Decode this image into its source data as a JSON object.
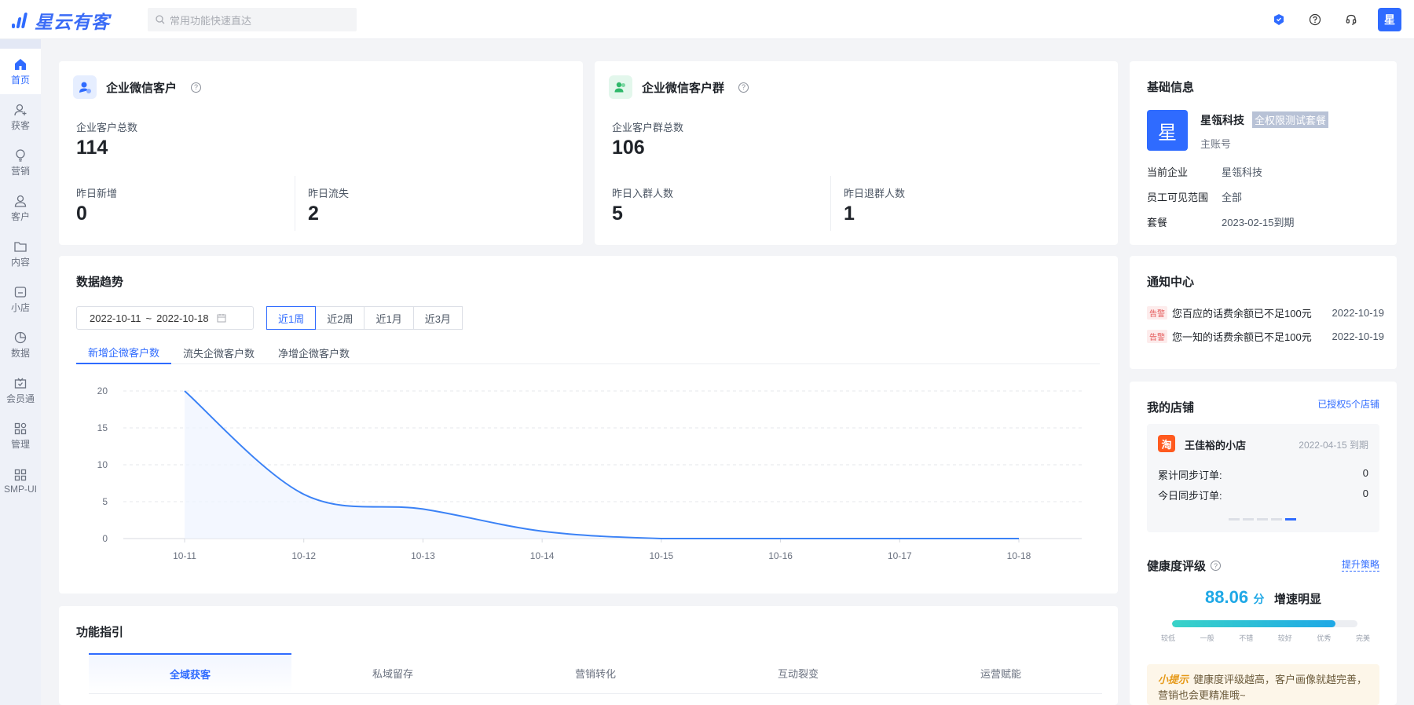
{
  "app": {
    "logo_text": "星云有客",
    "search_placeholder": "常用功能快速直达",
    "avatar_letter": "星"
  },
  "sidebar": {
    "items": [
      {
        "label": "首页",
        "icon": "home-icon",
        "active": true
      },
      {
        "label": "获客",
        "icon": "user-add-icon"
      },
      {
        "label": "营销",
        "icon": "bulb-icon"
      },
      {
        "label": "客户",
        "icon": "user-icon"
      },
      {
        "label": "内容",
        "icon": "folder-icon"
      },
      {
        "label": "小店",
        "icon": "shop-icon"
      },
      {
        "label": "数据",
        "icon": "pie-icon"
      },
      {
        "label": "会员通",
        "icon": "member-icon"
      },
      {
        "label": "管理",
        "icon": "grid-icon"
      },
      {
        "label": "SMP-UI",
        "icon": "apps-icon"
      }
    ]
  },
  "customer_card": {
    "title": "企业微信客户",
    "total_label": "企业客户总数",
    "total_value": "114",
    "new_label": "昨日新增",
    "new_value": "0",
    "lost_label": "昨日流失",
    "lost_value": "2"
  },
  "group_card": {
    "title": "企业微信客户群",
    "total_label": "企业客户群总数",
    "total_value": "106",
    "join_label": "昨日入群人数",
    "join_value": "5",
    "quit_label": "昨日退群人数",
    "quit_value": "1"
  },
  "basic_info": {
    "title": "基础信息",
    "avatar_letter": "星",
    "company_name": "星瓴科技",
    "plan_badge": "全权限测试套餐",
    "account_type": "主账号",
    "rows": [
      {
        "key": "当前企业",
        "value": "星瓴科技"
      },
      {
        "key": "员工可见范围",
        "value": "全部"
      },
      {
        "key": "套餐",
        "value": "2023-02-15到期"
      }
    ]
  },
  "trend": {
    "title": "数据趋势",
    "date_start": "2022-10-11",
    "date_sep": "~",
    "date_end": "2022-10-18",
    "ranges": [
      "近1周",
      "近2周",
      "近1月",
      "近3月"
    ],
    "active_range": 0,
    "tabs": [
      "新增企微客户数",
      "流失企微客户数",
      "净增企微客户数"
    ],
    "active_tab": 0
  },
  "chart_data": {
    "type": "area",
    "title": "",
    "xlabel": "",
    "ylabel": "",
    "categories": [
      "10-11",
      "10-12",
      "10-13",
      "10-14",
      "10-15",
      "10-16",
      "10-17",
      "10-18"
    ],
    "series": [
      {
        "values": [
          20,
          6,
          4,
          1,
          0,
          0,
          0,
          0
        ]
      }
    ],
    "ylim": [
      0,
      20
    ],
    "yticks": [
      "0",
      "5",
      "10",
      "15",
      "20"
    ],
    "grid": true,
    "line_color": "#3b82f6"
  },
  "notice": {
    "title": "通知中心",
    "items": [
      {
        "tag": "告警",
        "text": "您百应的话费余额已不足100元",
        "date": "2022-10-19"
      },
      {
        "tag": "告警",
        "text": "您一知的话费余额已不足100元",
        "date": "2022-10-19"
      }
    ]
  },
  "shops": {
    "title": "我的店铺",
    "authorized_link": "已授权5个店铺",
    "shop_icon_text": "淘",
    "shop_name": "王佳裕的小店",
    "expire": "2022-04-15 到期",
    "total_sync_label": "累计同步订单:",
    "total_sync_value": "0",
    "today_sync_label": "今日同步订单:",
    "today_sync_value": "0"
  },
  "health": {
    "title": "健康度评级",
    "link": "提升策略",
    "score": "88.06",
    "unit": "分",
    "status": "增速明显",
    "progress": 0.88,
    "levels": [
      "较低",
      "一般",
      "不错",
      "较好",
      "优秀",
      "完美"
    ],
    "tip_title": "小提示",
    "tip_text": "健康度评级越高，客户画像就越完善，营销也会更精准哦~"
  },
  "guide": {
    "title": "功能指引",
    "tabs": [
      "全域获客",
      "私域留存",
      "营销转化",
      "互动裂变",
      "运营赋能"
    ],
    "active_tab": 0
  }
}
